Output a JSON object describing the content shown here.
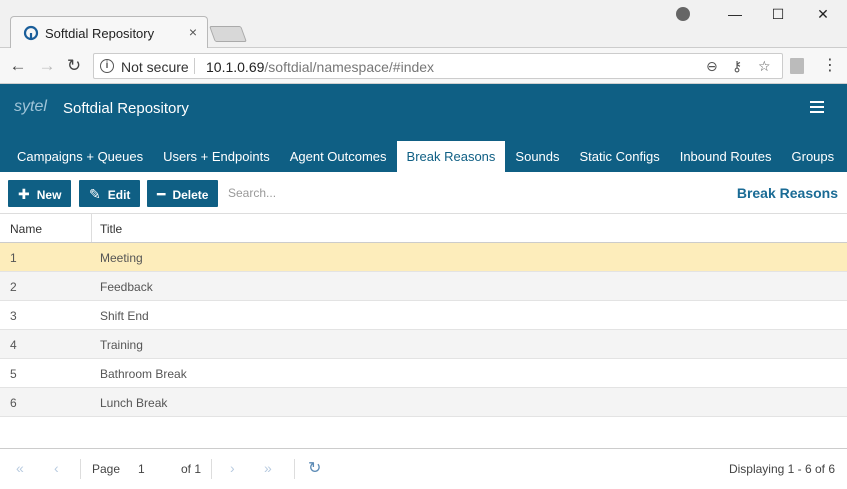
{
  "browser": {
    "tab_title": "Softdial Repository",
    "tab_close": "×",
    "win_minimize": "—",
    "win_maximize": "☐",
    "win_close": "✕",
    "back": "←",
    "forward": "→",
    "reload": "↻",
    "not_secure": "Not secure",
    "url_host": "10.1.0.69",
    "url_path": "/softdial/namespace/#index",
    "zoom_icon": "⊖",
    "key_icon": "⚷",
    "star_icon": "☆",
    "menu": "⋮"
  },
  "app": {
    "logo_text": "sytel",
    "title": "Softdial Repository",
    "nav": [
      {
        "label": "Campaigns + Queues"
      },
      {
        "label": "Users + Endpoints"
      },
      {
        "label": "Agent Outcomes"
      },
      {
        "label": "Break Reasons",
        "active": true
      },
      {
        "label": "Sounds"
      },
      {
        "label": "Static Configs"
      },
      {
        "label": "Inbound Routes"
      },
      {
        "label": "Groups"
      }
    ]
  },
  "toolbar": {
    "new_label": "New",
    "edit_label": "Edit",
    "delete_label": "Delete",
    "search_placeholder": "Search...",
    "panel_title": "Break Reasons"
  },
  "table": {
    "columns": [
      "Name",
      "Title"
    ],
    "rows": [
      {
        "name": "1",
        "title": "Meeting"
      },
      {
        "name": "2",
        "title": "Feedback"
      },
      {
        "name": "3",
        "title": "Shift End"
      },
      {
        "name": "4",
        "title": "Training"
      },
      {
        "name": "5",
        "title": "Bathroom Break"
      },
      {
        "name": "6",
        "title": "Lunch Break"
      }
    ],
    "selected_row": 0
  },
  "pager": {
    "first": "«",
    "prev": "‹",
    "page_label": "Page",
    "page_value": "1",
    "of_label": "of 1",
    "next": "›",
    "last": "»",
    "refresh": "↻",
    "display": "Displaying 1 - 6 of 6"
  },
  "colors": {
    "header_bg": "#0f5f84",
    "selected_row": "#fdedbb"
  }
}
